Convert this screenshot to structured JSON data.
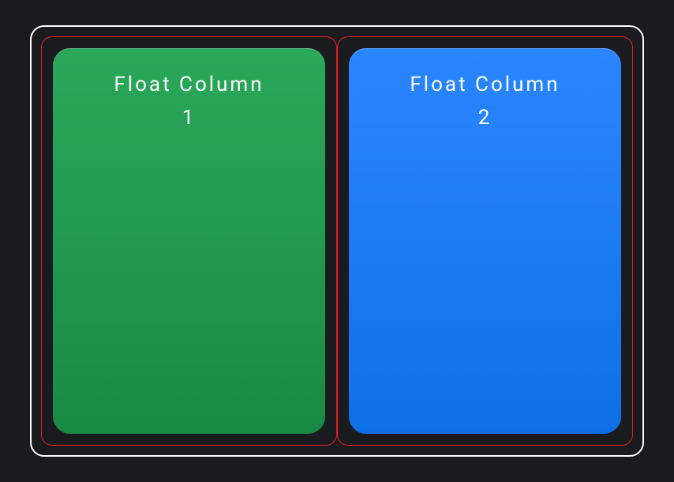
{
  "columns": [
    {
      "label_line1": "Float Column",
      "label_line2": "1",
      "color": "green"
    },
    {
      "label_line1": "Float Column",
      "label_line2": "2",
      "color": "blue"
    }
  ]
}
